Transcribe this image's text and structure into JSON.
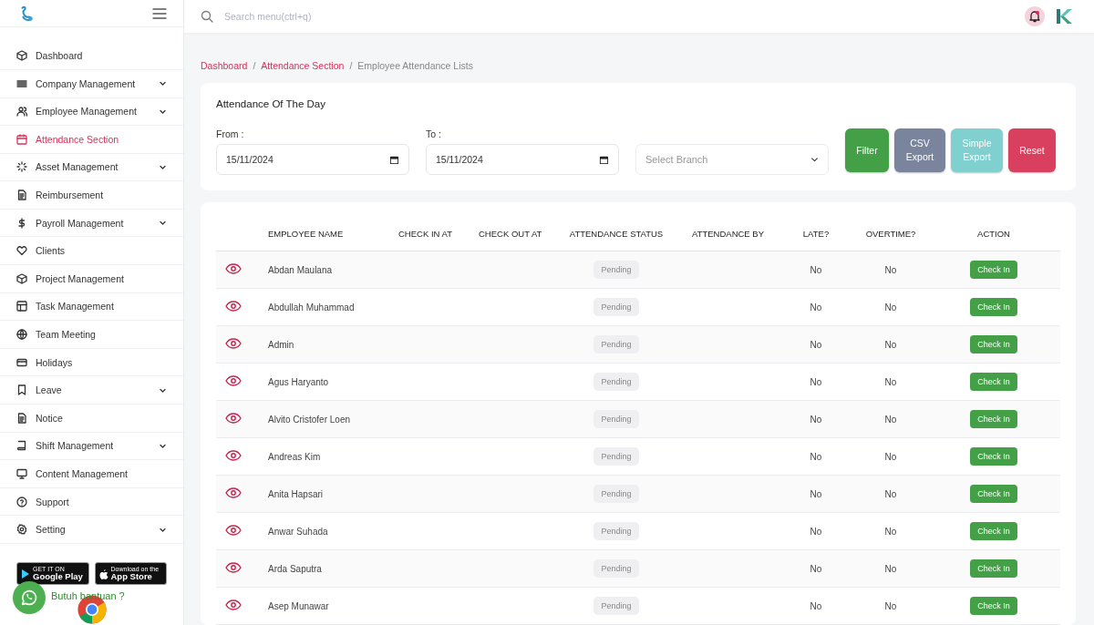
{
  "header": {
    "search": {
      "placeholder": "Search menu(ctrl+q)"
    },
    "notification": {
      "unread": true
    }
  },
  "sidebar": {
    "items": [
      {
        "label": "Dashboard",
        "expandable": false,
        "selected": false
      },
      {
        "label": "Company Management",
        "expandable": true,
        "selected": false
      },
      {
        "label": "Employee Management",
        "expandable": true,
        "selected": false
      },
      {
        "label": "Attendance Section",
        "expandable": false,
        "selected": true
      },
      {
        "label": "Asset Management",
        "expandable": true,
        "selected": false
      },
      {
        "label": "Reimbursement",
        "expandable": false,
        "selected": false
      },
      {
        "label": "Payroll Management",
        "expandable": true,
        "selected": false
      },
      {
        "label": "Clients",
        "expandable": false,
        "selected": false
      },
      {
        "label": "Project Management",
        "expandable": false,
        "selected": false
      },
      {
        "label": "Task Management",
        "expandable": false,
        "selected": false
      },
      {
        "label": "Team Meeting",
        "expandable": false,
        "selected": false
      },
      {
        "label": "Holidays",
        "expandable": false,
        "selected": false
      },
      {
        "label": "Leave",
        "expandable": true,
        "selected": false
      },
      {
        "label": "Notice",
        "expandable": false,
        "selected": false
      },
      {
        "label": "Shift Management",
        "expandable": true,
        "selected": false
      },
      {
        "label": "Content Management",
        "expandable": false,
        "selected": false
      },
      {
        "label": "Support",
        "expandable": false,
        "selected": false
      },
      {
        "label": "Setting",
        "expandable": true,
        "selected": false
      }
    ],
    "stores": [
      {
        "kind": "google",
        "small": "GET IT ON",
        "big": "Google Play"
      },
      {
        "kind": "apple",
        "small": "Download on the",
        "big": "App Store"
      }
    ],
    "help": {
      "label": "Butuh bantuan ?"
    }
  },
  "breadcrumb": [
    {
      "label": "Dashboard",
      "link": true,
      "separator": "/"
    },
    {
      "label": "Attendance Section",
      "link": true,
      "separator": "/"
    },
    {
      "label": "Employee Attendance Lists",
      "link": false
    }
  ],
  "filter": {
    "title": "Attendance Of The Day",
    "from": {
      "label": "From :",
      "value": "15/11/2024"
    },
    "to": {
      "label": "To :",
      "value": "15/11/2024"
    },
    "branch": {
      "placeholder": "Select Branch"
    },
    "buttons": [
      {
        "label": "Filter",
        "kind": "success"
      },
      {
        "label": "CSV Export",
        "kind": "secondary"
      },
      {
        "label": "Simple Export",
        "kind": "info"
      },
      {
        "label": "Reset",
        "kind": "danger"
      }
    ]
  },
  "table": {
    "columns": [
      "",
      "EMPLOYEE NAME",
      "CHECK IN AT",
      "CHECK OUT AT",
      "ATTENDANCE STATUS",
      "ATTENDANCE BY",
      "LATE?",
      "OVERTIME?",
      "ACTION"
    ],
    "rows": [
      {
        "name": "Abdan Maulana",
        "status": "Pending",
        "late": "No",
        "overtime": "No",
        "action": "Check In"
      },
      {
        "name": "Abdullah Muhammad",
        "status": "Pending",
        "late": "No",
        "overtime": "No",
        "action": "Check In"
      },
      {
        "name": "Admin",
        "status": "Pending",
        "late": "No",
        "overtime": "No",
        "action": "Check In"
      },
      {
        "name": "Agus Haryanto",
        "status": "Pending",
        "late": "No",
        "overtime": "No",
        "action": "Check In"
      },
      {
        "name": "Alvito Cristofer Loen",
        "status": "Pending",
        "late": "No",
        "overtime": "No",
        "action": "Check In"
      },
      {
        "name": "Andreas Kim",
        "status": "Pending",
        "late": "No",
        "overtime": "No",
        "action": "Check In"
      },
      {
        "name": "Anita Hapsari",
        "status": "Pending",
        "late": "No",
        "overtime": "No",
        "action": "Check In"
      },
      {
        "name": "Anwar Suhada",
        "status": "Pending",
        "late": "No",
        "overtime": "No",
        "action": "Check In"
      },
      {
        "name": "Arda Saputra",
        "status": "Pending",
        "late": "No",
        "overtime": "No",
        "action": "Check In"
      },
      {
        "name": "Asep Munawar",
        "status": "Pending",
        "late": "No",
        "overtime": "No",
        "action": "Check In"
      }
    ]
  }
}
